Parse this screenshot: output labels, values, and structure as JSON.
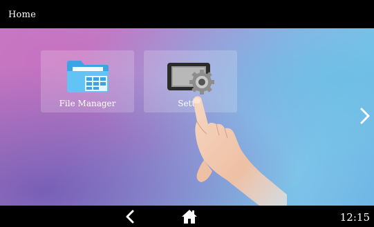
{
  "titlebar": {
    "title": "Home"
  },
  "apps": [
    {
      "label": "File Manager",
      "icon": "folder-icon"
    },
    {
      "label": "Settin",
      "icon": "settings-icon"
    }
  ],
  "navigation": {
    "back_icon": "back-arrow-icon",
    "home_icon": "home-icon",
    "next_page_icon": "chevron-right-icon"
  },
  "statusbar": {
    "time": "12:15"
  },
  "colors": {
    "bar_background": "#000000",
    "tile_background": "rgba(255,255,255,0.18)",
    "text": "#ffffff"
  }
}
